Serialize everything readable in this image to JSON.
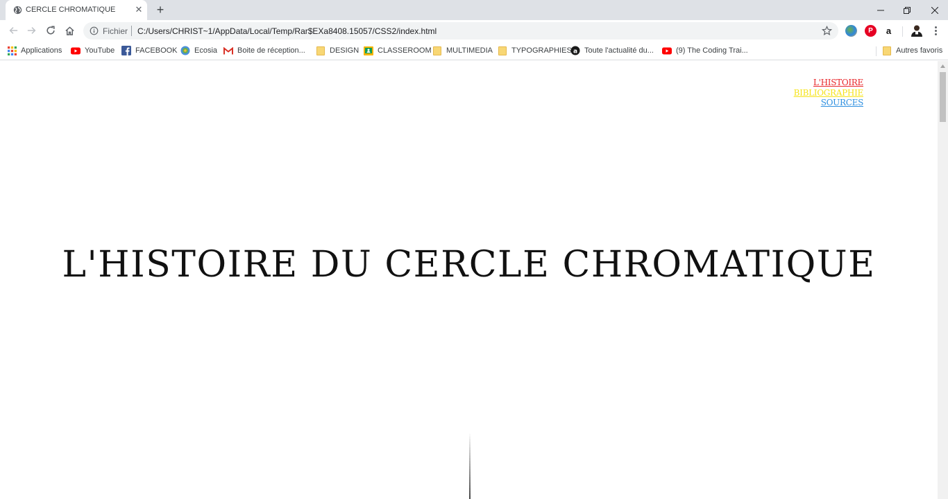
{
  "browser": {
    "tab": {
      "title": "CERCLE CHROMATIQUE"
    },
    "omnibox": {
      "scheme_label": "Fichier",
      "url": "C:/Users/CHRIST~1/AppData/Local/Temp/Rar$EXa8408.15057/CSS2/index.html"
    },
    "bookmarks": [
      {
        "label": "Applications",
        "icon": "apps-grid-icon"
      },
      {
        "label": "YouTube",
        "icon": "youtube-icon"
      },
      {
        "label": "FACEBOOK",
        "icon": "facebook-icon"
      },
      {
        "label": "Ecosia",
        "icon": "ecosia-icon"
      },
      {
        "label": "Boite de réception...",
        "icon": "gmail-icon"
      },
      {
        "label": "DESIGN",
        "icon": "folder-icon"
      },
      {
        "label": "CLASSEROOM",
        "icon": "classroom-icon"
      },
      {
        "label": "MULTIMEDIA",
        "icon": "folder-icon"
      },
      {
        "label": "TYPOGRAPHIES",
        "icon": "folder-icon"
      },
      {
        "label": "Toute l'actualité du...",
        "icon": "allocine-icon"
      },
      {
        "label": "(9) The Coding Trai...",
        "icon": "youtube-icon"
      }
    ],
    "other_bookmarks": {
      "label": "Autres favoris",
      "icon": "folder-icon"
    }
  },
  "page": {
    "nav": {
      "histoire": "L'HISTOIRE",
      "bibliographie": "BIBLIOGRAPHIE",
      "sources": "SOURCES"
    },
    "title": "L'HISTOIRE DU CERCLE CHROMATIQUE"
  },
  "colors": {
    "histoire_link": "#e8262a",
    "bibliographie_link": "#f5e31a",
    "sources_link": "#2d8fe0",
    "title": "#111111"
  }
}
